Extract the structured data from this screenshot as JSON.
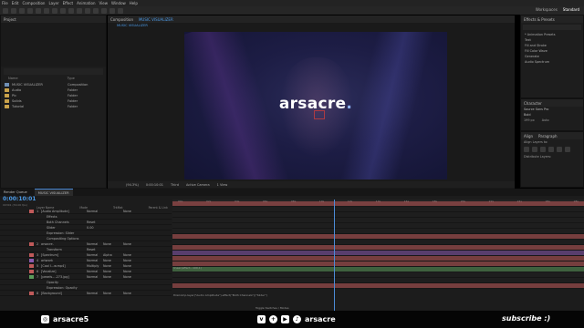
{
  "menu": [
    "File",
    "Edit",
    "Composition",
    "Layer",
    "Effect",
    "Animation",
    "View",
    "Window",
    "Help"
  ],
  "toolbar": {
    "workspace_label": "Workspaces",
    "workspace_value": "Standard",
    "search_placeholder": "Search Help"
  },
  "project": {
    "title": "Project",
    "col_name": "Name",
    "col_type": "Type",
    "items": [
      {
        "name": "MUSIC VISUALIZER",
        "type": "Composition",
        "kind": "comp"
      },
      {
        "name": "Audio",
        "type": "Folder",
        "kind": "folder"
      },
      {
        "name": "Pic",
        "type": "Folder",
        "kind": "folder"
      },
      {
        "name": "Solids",
        "type": "Folder",
        "kind": "folder"
      },
      {
        "name": "Tutorial",
        "type": "Folder",
        "kind": "folder"
      }
    ]
  },
  "viewer": {
    "tab_label": "Composition",
    "tab_comp": "MUSIC VISUALIZER",
    "breadcrumb": "MUSIC VISUALIZER",
    "title_text_main": "arsacre",
    "title_text_dot": ".",
    "footer": {
      "zoom": "(94.3%)",
      "time": "0:00:10:01",
      "quality": "Third",
      "camera": "Active Camera",
      "views": "1 View"
    }
  },
  "effects_presets": {
    "title": "Effects & Presets",
    "search_placeholder": "",
    "items": [
      "* Animation Presets",
      "Text",
      "Fill and Stroke",
      "Fill Color Wave",
      "Generate",
      "Audio Spectrum"
    ]
  },
  "character": {
    "title": "Character",
    "font": "Source Sans Pro",
    "style": "Bold",
    "size": "199 px",
    "tracking": "Auto"
  },
  "align": {
    "title": "Align",
    "paragraph_tab": "Paragraph",
    "align_layers_to": "Align Layers to:",
    "distribute_layers": "Distribute Layers:"
  },
  "timeline": {
    "tabs": [
      "Render Queue",
      "MUSIC VISUALIZER"
    ],
    "timecode": "0:00:10:01",
    "fps": "00301 (30.00 fps)",
    "columns": {
      "layer_name": "Layer Name",
      "mode": "Mode",
      "trkmat": "TrkMat",
      "parent": "Parent & Link"
    },
    "layers": [
      {
        "num": "1",
        "name": "[Audio Amplitude]",
        "mode": "Normal",
        "trk": "",
        "parent": "None",
        "color": "#c05a5a"
      },
      {
        "num": "",
        "name": "Effects",
        "mode": "",
        "trk": "",
        "parent": "",
        "color": ""
      },
      {
        "num": "",
        "name": "Both Channels",
        "mode": "Reset",
        "trk": "",
        "parent": "",
        "color": ""
      },
      {
        "num": "",
        "name": "Slider",
        "mode": "0.00",
        "trk": "",
        "parent": "",
        "color": ""
      },
      {
        "num": "",
        "name": "Expression: Slider",
        "mode": "",
        "trk": "",
        "parent": "",
        "color": ""
      },
      {
        "num": "",
        "name": "Compositing Options",
        "mode": "",
        "trk": "",
        "parent": "",
        "color": ""
      },
      {
        "num": "2",
        "name": "arsacre.",
        "mode": "Normal",
        "trk": "None",
        "parent": "None",
        "color": "#c05a5a"
      },
      {
        "num": "",
        "name": "Transform",
        "mode": "Reset",
        "trk": "",
        "parent": "",
        "color": ""
      },
      {
        "num": "3",
        "name": "[Spectrum]",
        "mode": "Normal",
        "trk": "Alpha",
        "parent": "None",
        "color": "#c05a5a"
      },
      {
        "num": "4",
        "name": "artwork",
        "mode": "Normal",
        "trk": "None",
        "parent": "None",
        "color": "#8a5ab0"
      },
      {
        "num": "5",
        "name": "[Cool I...w.mp4]",
        "mode": "Multiply",
        "trk": "None",
        "parent": "None",
        "color": "#c05a5a"
      },
      {
        "num": "6",
        "name": "[Vocalize]",
        "mode": "Normal",
        "trk": "None",
        "parent": "None",
        "color": "#c05a5a"
      },
      {
        "num": "7",
        "name": "[pexels-...273.jpg]",
        "mode": "Normal",
        "trk": "None",
        "parent": "None",
        "color": "#5a9a5a"
      },
      {
        "num": "",
        "name": "Opacity",
        "mode": "",
        "trk": "",
        "parent": "",
        "color": ""
      },
      {
        "num": "",
        "name": "Expression: Opacity",
        "mode": "",
        "trk": "",
        "parent": "",
        "color": ""
      },
      {
        "num": "8",
        "name": "[Background]",
        "mode": "Normal",
        "trk": "None",
        "parent": "None",
        "color": "#c05a5a"
      }
    ],
    "ruler_ticks": [
      "00s",
      "02s",
      "04s",
      "06s",
      "08s",
      "10s",
      "12s",
      "14s",
      "16s",
      "18s",
      "20s",
      "22s",
      "24s",
      "26s",
      "28s"
    ],
    "expr_text_1": "linear(effect...100,1)",
    "expr_text_2": "thisComp.layer(\"Audio Amplitude\").effect(\"Both Channels\")(\"Slider\")",
    "toggle_label": "Toggle Switches / Modes"
  },
  "footer": {
    "left_handle": "arsacre5",
    "center_handle": "arsacre",
    "right_text": "subscribe :)"
  }
}
